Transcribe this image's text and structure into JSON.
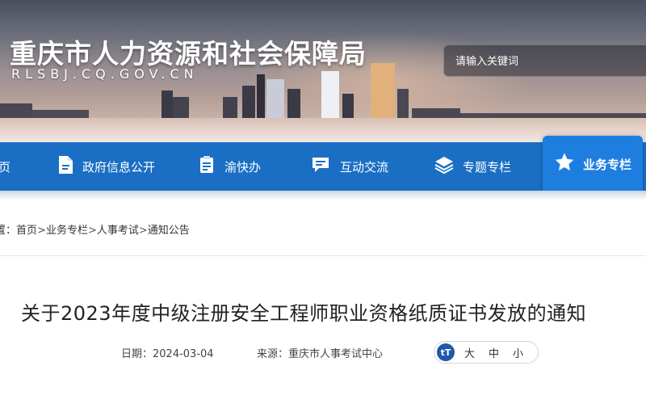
{
  "header": {
    "title": "重庆市人力资源和社会保障局",
    "domain": "RLSBJ.CQ.GOV.CN",
    "search_placeholder": "请输入关键词"
  },
  "nav": {
    "items": [
      {
        "label": "页",
        "icon": "home-icon"
      },
      {
        "label": "政府信息公开",
        "icon": "document-icon"
      },
      {
        "label": "渝快办",
        "icon": "clipboard-icon"
      },
      {
        "label": "互动交流",
        "icon": "chat-icon"
      },
      {
        "label": "专题专栏",
        "icon": "layers-icon"
      },
      {
        "label": "业务专栏",
        "icon": "star-icon",
        "active": true
      }
    ],
    "colors": {
      "bar": "#1a6fc4",
      "active": "#1e7ee0"
    }
  },
  "breadcrumb": {
    "prefix": "置：",
    "items": [
      "首页",
      "业务专栏",
      "人事考试",
      "通知公告"
    ],
    "separator": ">"
  },
  "article": {
    "title": "关于2023年度中级注册安全工程师职业资格纸质证书发放的通知",
    "date_label": "日期：",
    "date": "2024-03-04",
    "source_label": "来源：",
    "source": "重庆市人事考试中心"
  },
  "font_size": {
    "icon_text": "tT",
    "options": [
      "大",
      "中",
      "小"
    ]
  }
}
